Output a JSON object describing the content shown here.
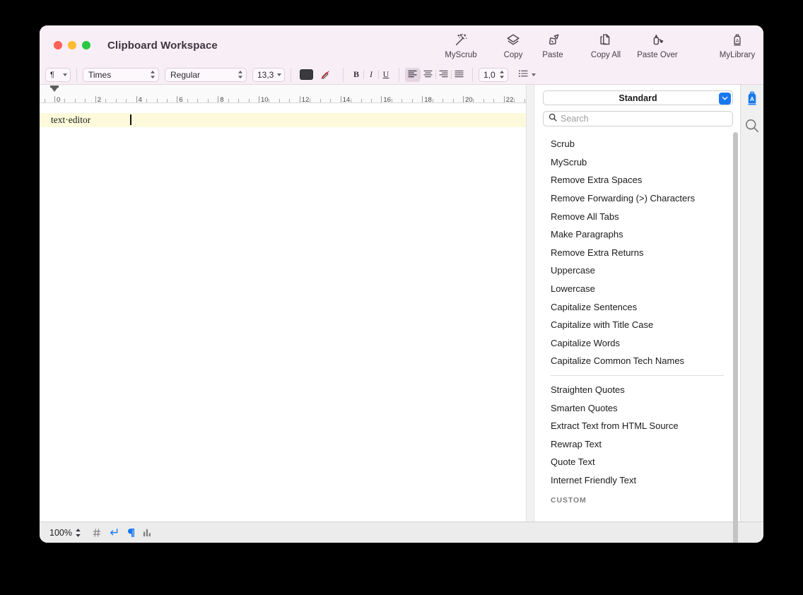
{
  "window": {
    "title": "Clipboard Workspace",
    "traffic_lights": [
      "close",
      "minimize",
      "zoom"
    ]
  },
  "toolbar": {
    "items": [
      {
        "icon": "magic-wand-icon",
        "label": "MyScrub"
      },
      {
        "icon": "copy-layers-icon",
        "label": "Copy"
      },
      {
        "icon": "paste-glue-bottle-icon",
        "label": "Paste"
      },
      {
        "icon": "copy-all-pages-icon",
        "label": "Copy All"
      },
      {
        "icon": "paste-over-arrow-icon",
        "label": "Paste Over"
      },
      {
        "icon": "library-jar-icon",
        "label": "MyLibrary"
      }
    ]
  },
  "formatbar": {
    "paragraph_style": "¶",
    "font_family": "Times",
    "font_style": "Regular",
    "font_size": "13,3",
    "text_color": "#3a3a3f",
    "highlight_icon": "highlighter-pen-icon",
    "bold": "B",
    "italic": "I",
    "underline": "U",
    "alignment_selected": "left",
    "alignments": [
      "align-left",
      "align-center",
      "align-right",
      "align-justify"
    ],
    "line_spacing": "1,0",
    "list_style": "list-bullet"
  },
  "ruler": {
    "unit_numbers": [
      "0",
      "2",
      "4",
      "6",
      "8",
      "10",
      "12",
      "14",
      "16",
      "18",
      "20",
      "22"
    ],
    "left_indent": "0",
    "right_margin": "22"
  },
  "editor": {
    "text": "text·editor",
    "active_line_color": "#fcfadb"
  },
  "panel": {
    "preset": "Standard",
    "search_placeholder": "Search",
    "search_value": "",
    "accent_color": "#1878f0",
    "groups": [
      {
        "items": [
          "Scrub",
          "MyScrub",
          "Remove Extra Spaces",
          "Remove Forwarding (>) Characters",
          "Remove All Tabs",
          "Make Paragraphs",
          "Remove Extra Returns",
          "Uppercase",
          "Lowercase",
          "Capitalize Sentences",
          "Capitalize with Title Case",
          "Capitalize Words",
          "Capitalize Common Tech Names"
        ]
      },
      {
        "items": [
          "Straighten Quotes",
          "Smarten Quotes",
          "Extract Text from HTML Source",
          "Rewrap Text",
          "Quote Text",
          "Internet Friendly Text"
        ]
      }
    ],
    "section_header": "CUSTOM"
  },
  "rail": {
    "buttons": [
      {
        "icon": "library-jar-icon",
        "active": true
      },
      {
        "icon": "search-magnifier-icon",
        "active": false
      }
    ]
  },
  "statusbar": {
    "zoom": "100%",
    "buttons": [
      {
        "icon": "hash-icon",
        "state": "inactive"
      },
      {
        "icon": "return-arrow-icon",
        "state": "active"
      },
      {
        "icon": "pilcrow-icon",
        "state": "active"
      },
      {
        "icon": "bar-chart-icon",
        "state": "inactive"
      }
    ]
  }
}
